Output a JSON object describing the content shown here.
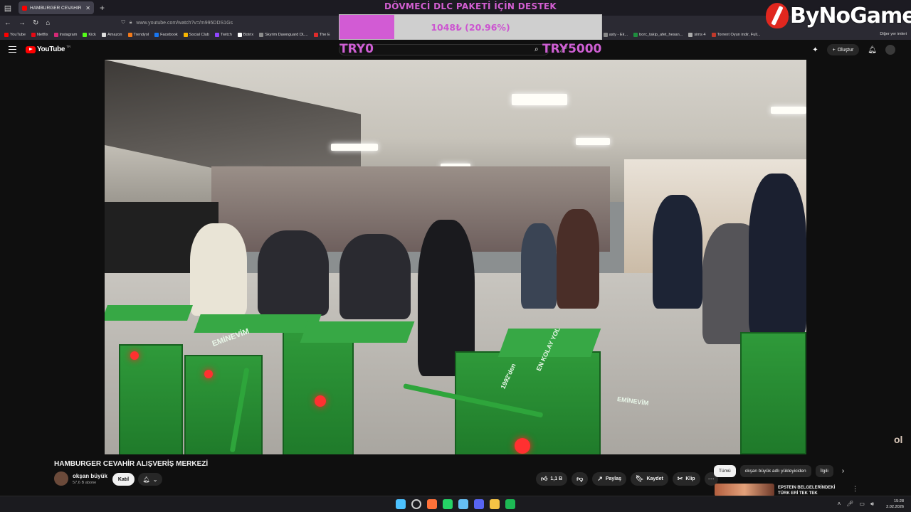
{
  "browser": {
    "tab_title": "HAMBURGER CEVAHİR ALIŞVERİ",
    "url": "www.youtube.com/watch?v=/m995DDS1Gs",
    "bookmarks": [
      {
        "label": "YouTube",
        "color": "#ff0000"
      },
      {
        "label": "Netflix",
        "color": "#e50914"
      },
      {
        "label": "Instagram",
        "color": "#d62976"
      },
      {
        "label": "Kick",
        "color": "#53fc18"
      },
      {
        "label": "Amazon",
        "color": "#dddddd"
      },
      {
        "label": "Trendyol",
        "color": "#f27a1a"
      },
      {
        "label": "Facebook",
        "color": "#1877f2"
      },
      {
        "label": "Social Club",
        "color": "#f7b500"
      },
      {
        "label": "Twitch",
        "color": "#9146ff"
      },
      {
        "label": "Botrix",
        "color": "#ffffff"
      },
      {
        "label": "Skyrim Dawnguard DL...",
        "color": "#8b8b8b"
      },
      {
        "label": "The E",
        "color": "#e02b2b"
      }
    ],
    "bookmarks_right": [
      {
        "label": "asty - Ek...",
        "color": "#888888"
      },
      {
        "label": "borc_takip_afet_hesan...",
        "color": "#1e8e3e"
      },
      {
        "label": "sims 4",
        "color": "#aaaaaa"
      },
      {
        "label": "Torrent Oyun indir, Full...",
        "color": "#c0392b"
      }
    ],
    "other_bookmarks": "Diğer yer imleri"
  },
  "donation": {
    "title": "DÖVMECİ DLC PAKETİ İÇİN DESTEK",
    "amount": "1048₺ (20.96%)",
    "progress": 20.96,
    "min": "TRY0",
    "max": "TRY5000",
    "color": "#d25bd4"
  },
  "overlay_logo": "ByNoGame",
  "youtube": {
    "logo": "YouTube",
    "region": "TR",
    "create_label": "Oluştur"
  },
  "video": {
    "title": "HAMBURGER CEVAHİR ALIŞVERİŞ MERKEZİ",
    "channel": "okşan büyük",
    "subscribers": "57,6 B abone",
    "join_label": "Katıl",
    "likes": "1,1 B",
    "share_label": "Paylaş",
    "save_label": "Kaydet",
    "clip_label": "Klip",
    "scene_text": {
      "gate_brand": "EMİNEVİM",
      "gate_slogan": "EN KOLAY YOL",
      "gate_year": "1992'den",
      "watermark": "ol"
    }
  },
  "sidebar": {
    "chips": [
      "Tümü",
      "okşan büyük adlı yükleyiciden",
      "İlgili"
    ],
    "rec_title": "EPSTEIN BELGELERİNDEKİ TÜRK ERİ TEK TEK"
  },
  "taskbar": {
    "time": "15:28",
    "date": "2.02.2026",
    "apps": [
      {
        "name": "windows",
        "color": "#4cc2ff"
      },
      {
        "name": "search",
        "color": "#cccccc"
      },
      {
        "name": "firefox",
        "color": "#ff7139"
      },
      {
        "name": "whatsapp",
        "color": "#25d366"
      },
      {
        "name": "steam",
        "color": "#66c0f4"
      },
      {
        "name": "discord",
        "color": "#5865f2"
      },
      {
        "name": "files",
        "color": "#f6c445"
      },
      {
        "name": "spotify",
        "color": "#1db954"
      }
    ]
  }
}
